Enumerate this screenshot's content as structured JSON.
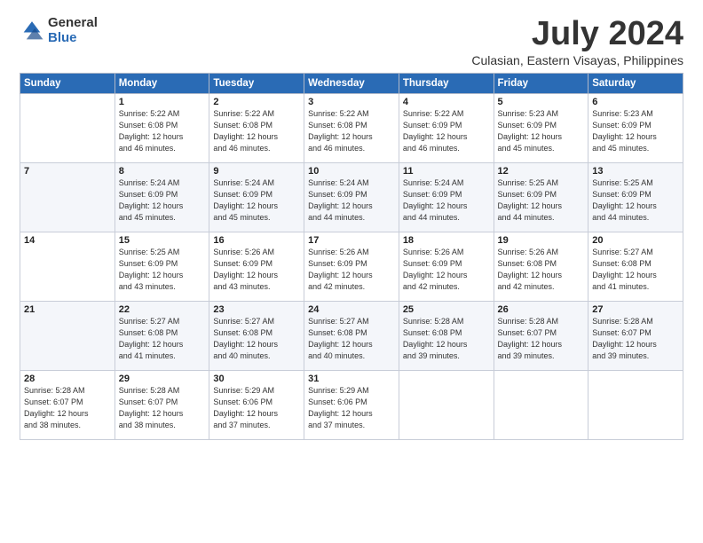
{
  "logo": {
    "general": "General",
    "blue": "Blue"
  },
  "header": {
    "month": "July 2024",
    "location": "Culasian, Eastern Visayas, Philippines"
  },
  "days_of_week": [
    "Sunday",
    "Monday",
    "Tuesday",
    "Wednesday",
    "Thursday",
    "Friday",
    "Saturday"
  ],
  "weeks": [
    [
      {
        "day": "",
        "info": ""
      },
      {
        "day": "1",
        "info": "Sunrise: 5:22 AM\nSunset: 6:08 PM\nDaylight: 12 hours\nand 46 minutes."
      },
      {
        "day": "2",
        "info": "Sunrise: 5:22 AM\nSunset: 6:08 PM\nDaylight: 12 hours\nand 46 minutes."
      },
      {
        "day": "3",
        "info": "Sunrise: 5:22 AM\nSunset: 6:08 PM\nDaylight: 12 hours\nand 46 minutes."
      },
      {
        "day": "4",
        "info": "Sunrise: 5:22 AM\nSunset: 6:09 PM\nDaylight: 12 hours\nand 46 minutes."
      },
      {
        "day": "5",
        "info": "Sunrise: 5:23 AM\nSunset: 6:09 PM\nDaylight: 12 hours\nand 45 minutes."
      },
      {
        "day": "6",
        "info": "Sunrise: 5:23 AM\nSunset: 6:09 PM\nDaylight: 12 hours\nand 45 minutes."
      }
    ],
    [
      {
        "day": "7",
        "info": ""
      },
      {
        "day": "8",
        "info": "Sunrise: 5:24 AM\nSunset: 6:09 PM\nDaylight: 12 hours\nand 45 minutes."
      },
      {
        "day": "9",
        "info": "Sunrise: 5:24 AM\nSunset: 6:09 PM\nDaylight: 12 hours\nand 45 minutes."
      },
      {
        "day": "10",
        "info": "Sunrise: 5:24 AM\nSunset: 6:09 PM\nDaylight: 12 hours\nand 44 minutes."
      },
      {
        "day": "11",
        "info": "Sunrise: 5:24 AM\nSunset: 6:09 PM\nDaylight: 12 hours\nand 44 minutes."
      },
      {
        "day": "12",
        "info": "Sunrise: 5:25 AM\nSunset: 6:09 PM\nDaylight: 12 hours\nand 44 minutes."
      },
      {
        "day": "13",
        "info": "Sunrise: 5:25 AM\nSunset: 6:09 PM\nDaylight: 12 hours\nand 44 minutes."
      }
    ],
    [
      {
        "day": "14",
        "info": ""
      },
      {
        "day": "15",
        "info": "Sunrise: 5:25 AM\nSunset: 6:09 PM\nDaylight: 12 hours\nand 43 minutes."
      },
      {
        "day": "16",
        "info": "Sunrise: 5:26 AM\nSunset: 6:09 PM\nDaylight: 12 hours\nand 43 minutes."
      },
      {
        "day": "17",
        "info": "Sunrise: 5:26 AM\nSunset: 6:09 PM\nDaylight: 12 hours\nand 42 minutes."
      },
      {
        "day": "18",
        "info": "Sunrise: 5:26 AM\nSunset: 6:09 PM\nDaylight: 12 hours\nand 42 minutes."
      },
      {
        "day": "19",
        "info": "Sunrise: 5:26 AM\nSunset: 6:08 PM\nDaylight: 12 hours\nand 42 minutes."
      },
      {
        "day": "20",
        "info": "Sunrise: 5:27 AM\nSunset: 6:08 PM\nDaylight: 12 hours\nand 41 minutes."
      }
    ],
    [
      {
        "day": "21",
        "info": ""
      },
      {
        "day": "22",
        "info": "Sunrise: 5:27 AM\nSunset: 6:08 PM\nDaylight: 12 hours\nand 41 minutes."
      },
      {
        "day": "23",
        "info": "Sunrise: 5:27 AM\nSunset: 6:08 PM\nDaylight: 12 hours\nand 40 minutes."
      },
      {
        "day": "24",
        "info": "Sunrise: 5:27 AM\nSunset: 6:08 PM\nDaylight: 12 hours\nand 40 minutes."
      },
      {
        "day": "25",
        "info": "Sunrise: 5:28 AM\nSunset: 6:08 PM\nDaylight: 12 hours\nand 39 minutes."
      },
      {
        "day": "26",
        "info": "Sunrise: 5:28 AM\nSunset: 6:07 PM\nDaylight: 12 hours\nand 39 minutes."
      },
      {
        "day": "27",
        "info": "Sunrise: 5:28 AM\nSunset: 6:07 PM\nDaylight: 12 hours\nand 39 minutes."
      }
    ],
    [
      {
        "day": "28",
        "info": "Sunrise: 5:28 AM\nSunset: 6:07 PM\nDaylight: 12 hours\nand 38 minutes."
      },
      {
        "day": "29",
        "info": "Sunrise: 5:28 AM\nSunset: 6:07 PM\nDaylight: 12 hours\nand 38 minutes."
      },
      {
        "day": "30",
        "info": "Sunrise: 5:29 AM\nSunset: 6:06 PM\nDaylight: 12 hours\nand 37 minutes."
      },
      {
        "day": "31",
        "info": "Sunrise: 5:29 AM\nSunset: 6:06 PM\nDaylight: 12 hours\nand 37 minutes."
      },
      {
        "day": "",
        "info": ""
      },
      {
        "day": "",
        "info": ""
      },
      {
        "day": "",
        "info": ""
      }
    ]
  ]
}
